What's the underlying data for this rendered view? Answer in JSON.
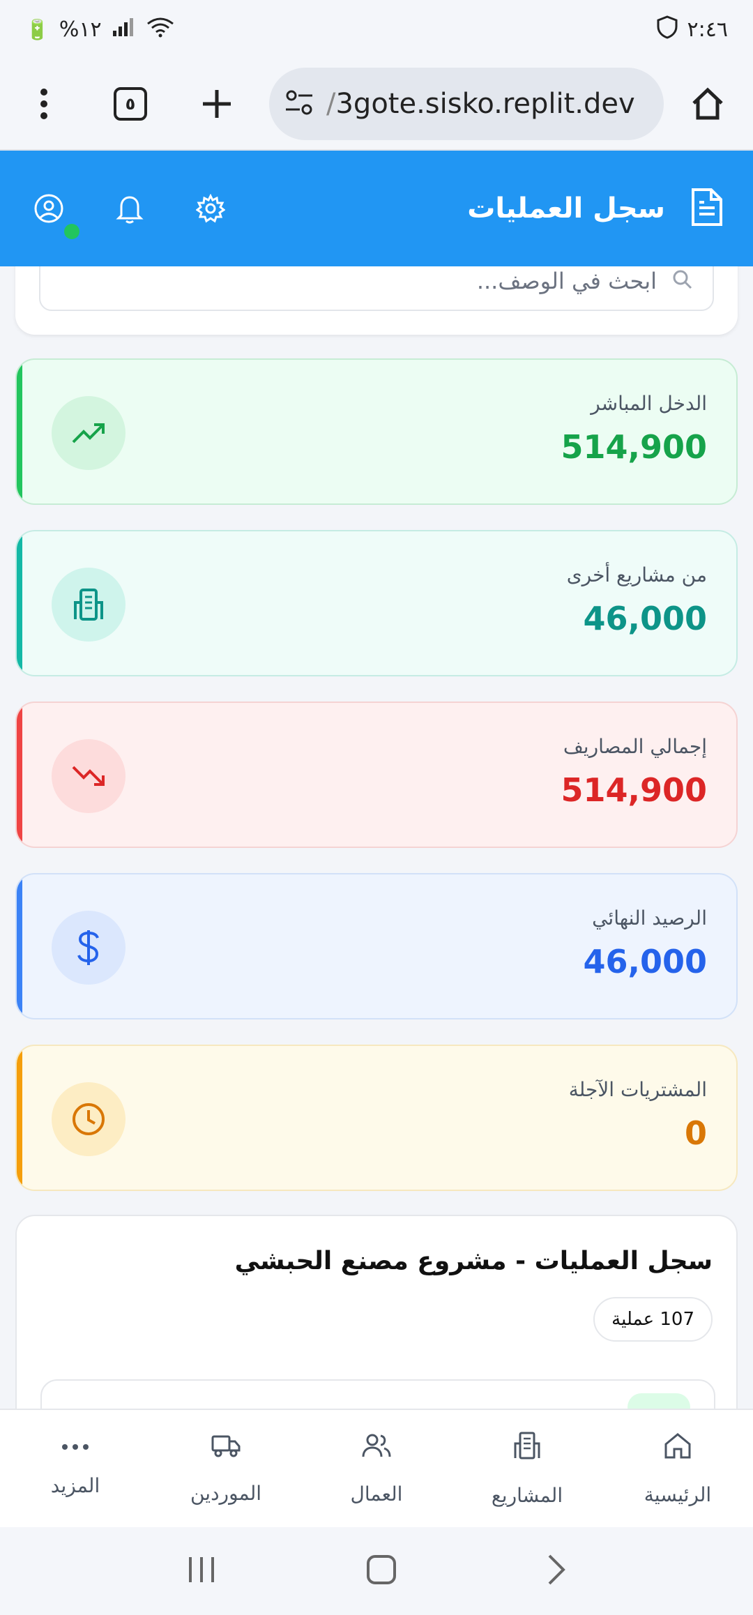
{
  "status": {
    "time": "٢:٤٦",
    "battery": "%١٢"
  },
  "browser": {
    "url_dim": "/",
    "url": "3gote.sisko.replit.dev",
    "tabs_count": "٥"
  },
  "header": {
    "title": "سجل العمليات"
  },
  "search": {
    "placeholder": "ابحث في الوصف..."
  },
  "stats": [
    {
      "label": "الدخل المباشر",
      "value": "514,900"
    },
    {
      "label": "من مشاريع أخرى",
      "value": "46,000"
    },
    {
      "label": "إجمالي المصاريف",
      "value": "514,900"
    },
    {
      "label": "الرصيد النهائي",
      "value": "46,000"
    },
    {
      "label": "المشتريات الآجلة",
      "value": "0"
    }
  ],
  "log": {
    "title": "سجل العمليات - مشروع مصنع الحبشي",
    "count_badge": "107 عملية"
  },
  "nav": [
    {
      "label": "المزيد"
    },
    {
      "label": "الموردين"
    },
    {
      "label": "العمال"
    },
    {
      "label": "المشاريع"
    },
    {
      "label": "الرئيسية"
    }
  ],
  "colors": {
    "header": "#2196f3",
    "income": "#16a34a",
    "other_projects": "#0d9488",
    "expenses": "#dc2626",
    "balance": "#2563eb",
    "deferred": "#d97706"
  }
}
